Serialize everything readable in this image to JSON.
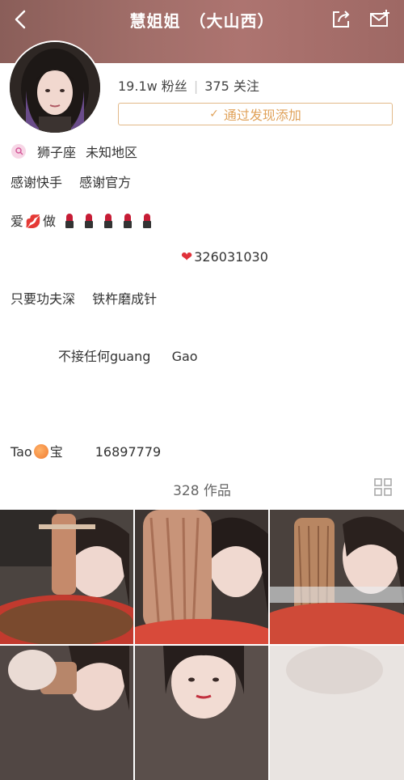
{
  "header": {
    "title": "慧姐姐　（大山西）",
    "colors": {
      "background": "#a16e69",
      "text": "#ffffff"
    }
  },
  "profile": {
    "fans_label": "19.1w 粉丝",
    "following_label": "375 关注",
    "follow_button": "通过发现添加",
    "location_sign": "狮子座",
    "location_area": "未知地区"
  },
  "bio": {
    "line1": "感谢快手　 感谢官方",
    "line2_word1": "爱",
    "line2_word2": "做",
    "line3_number": "326031030",
    "line4": "只要功夫深　 铁杵磨成针",
    "line5": "不接任何guang　  Gao",
    "line6_word1": "Tao",
    "line6_word2": "宝",
    "line6_number": "16897779"
  },
  "works": {
    "count_label": "328 作品"
  },
  "icons": [
    "back-arrow-icon",
    "share-icon",
    "message-icon",
    "location-pin-icon",
    "grid-layout-icon"
  ]
}
